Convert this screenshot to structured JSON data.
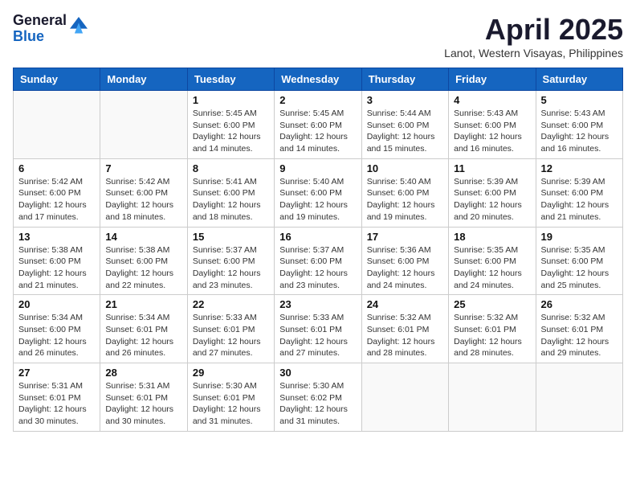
{
  "header": {
    "logo_general": "General",
    "logo_blue": "Blue",
    "month_title": "April 2025",
    "location": "Lanot, Western Visayas, Philippines"
  },
  "days_of_week": [
    "Sunday",
    "Monday",
    "Tuesday",
    "Wednesday",
    "Thursday",
    "Friday",
    "Saturday"
  ],
  "weeks": [
    [
      {
        "day": "",
        "info": ""
      },
      {
        "day": "",
        "info": ""
      },
      {
        "day": "1",
        "info": "Sunrise: 5:45 AM\nSunset: 6:00 PM\nDaylight: 12 hours and 14 minutes."
      },
      {
        "day": "2",
        "info": "Sunrise: 5:45 AM\nSunset: 6:00 PM\nDaylight: 12 hours and 14 minutes."
      },
      {
        "day": "3",
        "info": "Sunrise: 5:44 AM\nSunset: 6:00 PM\nDaylight: 12 hours and 15 minutes."
      },
      {
        "day": "4",
        "info": "Sunrise: 5:43 AM\nSunset: 6:00 PM\nDaylight: 12 hours and 16 minutes."
      },
      {
        "day": "5",
        "info": "Sunrise: 5:43 AM\nSunset: 6:00 PM\nDaylight: 12 hours and 16 minutes."
      }
    ],
    [
      {
        "day": "6",
        "info": "Sunrise: 5:42 AM\nSunset: 6:00 PM\nDaylight: 12 hours and 17 minutes."
      },
      {
        "day": "7",
        "info": "Sunrise: 5:42 AM\nSunset: 6:00 PM\nDaylight: 12 hours and 18 minutes."
      },
      {
        "day": "8",
        "info": "Sunrise: 5:41 AM\nSunset: 6:00 PM\nDaylight: 12 hours and 18 minutes."
      },
      {
        "day": "9",
        "info": "Sunrise: 5:40 AM\nSunset: 6:00 PM\nDaylight: 12 hours and 19 minutes."
      },
      {
        "day": "10",
        "info": "Sunrise: 5:40 AM\nSunset: 6:00 PM\nDaylight: 12 hours and 19 minutes."
      },
      {
        "day": "11",
        "info": "Sunrise: 5:39 AM\nSunset: 6:00 PM\nDaylight: 12 hours and 20 minutes."
      },
      {
        "day": "12",
        "info": "Sunrise: 5:39 AM\nSunset: 6:00 PM\nDaylight: 12 hours and 21 minutes."
      }
    ],
    [
      {
        "day": "13",
        "info": "Sunrise: 5:38 AM\nSunset: 6:00 PM\nDaylight: 12 hours and 21 minutes."
      },
      {
        "day": "14",
        "info": "Sunrise: 5:38 AM\nSunset: 6:00 PM\nDaylight: 12 hours and 22 minutes."
      },
      {
        "day": "15",
        "info": "Sunrise: 5:37 AM\nSunset: 6:00 PM\nDaylight: 12 hours and 23 minutes."
      },
      {
        "day": "16",
        "info": "Sunrise: 5:37 AM\nSunset: 6:00 PM\nDaylight: 12 hours and 23 minutes."
      },
      {
        "day": "17",
        "info": "Sunrise: 5:36 AM\nSunset: 6:00 PM\nDaylight: 12 hours and 24 minutes."
      },
      {
        "day": "18",
        "info": "Sunrise: 5:35 AM\nSunset: 6:00 PM\nDaylight: 12 hours and 24 minutes."
      },
      {
        "day": "19",
        "info": "Sunrise: 5:35 AM\nSunset: 6:00 PM\nDaylight: 12 hours and 25 minutes."
      }
    ],
    [
      {
        "day": "20",
        "info": "Sunrise: 5:34 AM\nSunset: 6:00 PM\nDaylight: 12 hours and 26 minutes."
      },
      {
        "day": "21",
        "info": "Sunrise: 5:34 AM\nSunset: 6:01 PM\nDaylight: 12 hours and 26 minutes."
      },
      {
        "day": "22",
        "info": "Sunrise: 5:33 AM\nSunset: 6:01 PM\nDaylight: 12 hours and 27 minutes."
      },
      {
        "day": "23",
        "info": "Sunrise: 5:33 AM\nSunset: 6:01 PM\nDaylight: 12 hours and 27 minutes."
      },
      {
        "day": "24",
        "info": "Sunrise: 5:32 AM\nSunset: 6:01 PM\nDaylight: 12 hours and 28 minutes."
      },
      {
        "day": "25",
        "info": "Sunrise: 5:32 AM\nSunset: 6:01 PM\nDaylight: 12 hours and 28 minutes."
      },
      {
        "day": "26",
        "info": "Sunrise: 5:32 AM\nSunset: 6:01 PM\nDaylight: 12 hours and 29 minutes."
      }
    ],
    [
      {
        "day": "27",
        "info": "Sunrise: 5:31 AM\nSunset: 6:01 PM\nDaylight: 12 hours and 30 minutes."
      },
      {
        "day": "28",
        "info": "Sunrise: 5:31 AM\nSunset: 6:01 PM\nDaylight: 12 hours and 30 minutes."
      },
      {
        "day": "29",
        "info": "Sunrise: 5:30 AM\nSunset: 6:01 PM\nDaylight: 12 hours and 31 minutes."
      },
      {
        "day": "30",
        "info": "Sunrise: 5:30 AM\nSunset: 6:02 PM\nDaylight: 12 hours and 31 minutes."
      },
      {
        "day": "",
        "info": ""
      },
      {
        "day": "",
        "info": ""
      },
      {
        "day": "",
        "info": ""
      }
    ]
  ]
}
